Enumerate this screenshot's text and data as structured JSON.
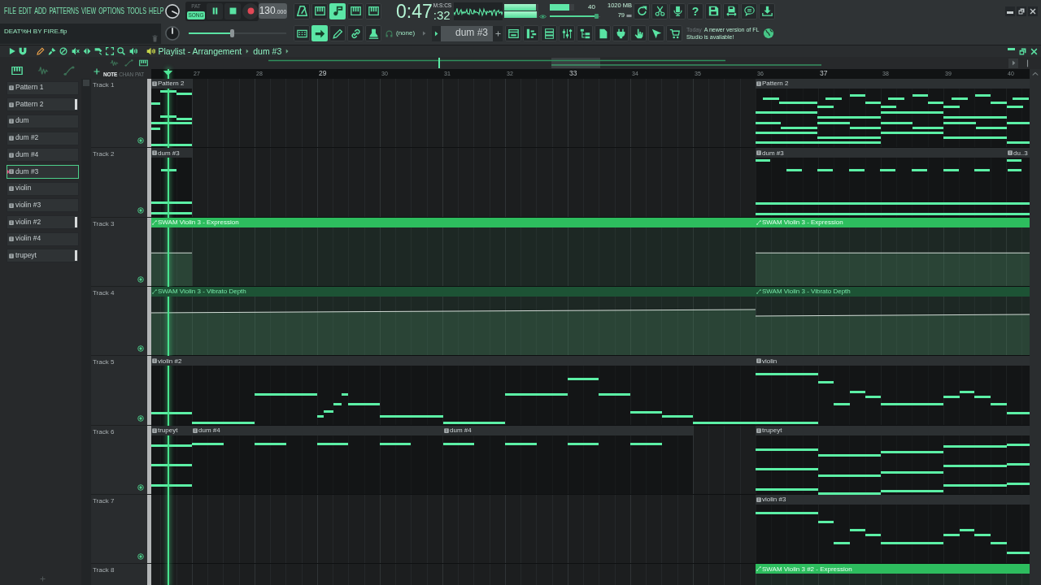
{
  "menu": [
    "FILE",
    "EDIT",
    "ADD",
    "PATTERNS",
    "VIEW",
    "OPTIONS",
    "TOOLS",
    "HELP"
  ],
  "project": {
    "filename": "DEAT%H BY FIRE.flp"
  },
  "transport": {
    "modes": [
      {
        "label": "PAT",
        "selected": false
      },
      {
        "label": "SONG",
        "selected": true
      }
    ],
    "tempo": {
      "whole": "130",
      "fraction": ".000"
    }
  },
  "record_tools": [
    {
      "on": false
    },
    {
      "on": false
    },
    {
      "on": true
    },
    {
      "on": false
    },
    {
      "on": false
    }
  ],
  "time": {
    "value": "0:47",
    "fraction": ":32",
    "unit": "M:S:CS"
  },
  "output_meter": {
    "channels": [
      {
        "level": 0.93
      },
      {
        "level": 0.95
      }
    ]
  },
  "cpu": {
    "level": 0.8,
    "reading": "40"
  },
  "polyphony": {
    "level": 0.97,
    "reading": "79"
  },
  "memory": {
    "reading": "1020 MB"
  },
  "help_label": "?",
  "master_volume": {
    "level": 0.44
  },
  "edit_tools": [
    {
      "on": false
    },
    {
      "on": true
    },
    {
      "on": false
    },
    {
      "on": false
    },
    {
      "on": false
    }
  ],
  "midi_input": {
    "value": "(none)"
  },
  "pattern_selector": {
    "value": "dum #3"
  },
  "news": {
    "date": "Today",
    "text": "A newer version of FL Studio is available!"
  },
  "playlist": {
    "title": "Playlist - Arrangement",
    "breadcrumb": "dum #3",
    "tools": [
      {
        "selected": true
      },
      {
        "selected": false
      },
      {
        "selected": false
      },
      {
        "selected": false
      },
      {
        "selected": false
      },
      {
        "selected": false
      },
      {
        "selected": false
      },
      {
        "selected": false
      },
      {
        "selected": false
      }
    ]
  },
  "picker": {
    "views": [
      {
        "selected": true
      },
      {
        "selected": false
      },
      {
        "selected": false
      }
    ],
    "modes": [
      {
        "selected": false
      },
      {
        "selected": false
      },
      {
        "selected": true
      }
    ],
    "filters": [
      {
        "label": "NOTE",
        "selected": true
      },
      {
        "label": "CHAN",
        "selected": false
      },
      {
        "label": "PAT",
        "selected": false
      }
    ],
    "patterns": [
      {
        "label": "Pattern 1",
        "selected": false,
        "marked": false
      },
      {
        "label": "Pattern 2",
        "selected": false,
        "marked": true
      },
      {
        "label": "dum",
        "selected": false,
        "marked": false
      },
      {
        "label": "dum #2",
        "selected": false,
        "marked": false
      },
      {
        "label": "dum #4",
        "selected": false,
        "marked": false
      },
      {
        "label": "dum #3",
        "selected": true,
        "marked": false
      },
      {
        "label": "violin",
        "selected": false,
        "marked": false
      },
      {
        "label": "violin #3",
        "selected": false,
        "marked": false
      },
      {
        "label": "violin #2",
        "selected": false,
        "marked": true
      },
      {
        "label": "violin #4",
        "selected": false,
        "marked": false
      },
      {
        "label": "trupeyt",
        "selected": false,
        "marked": true
      }
    ]
  },
  "ruler": [
    "27",
    "28",
    "29",
    "30",
    "31",
    "32",
    "33",
    "34",
    "35",
    "36",
    "37",
    "38",
    "39",
    "40"
  ],
  "tracks": [
    {
      "name": "Track 1",
      "clips": [
        {
          "kind": "pattern",
          "label": "Pattern 2"
        },
        {
          "kind": "pattern",
          "label": "Pattern 2"
        }
      ]
    },
    {
      "name": "Track 2",
      "clips": [
        {
          "kind": "pattern",
          "label": "dum #3"
        },
        {
          "kind": "pattern",
          "label": "dum #3"
        },
        {
          "kind": "pattern",
          "label": "du..3"
        }
      ]
    },
    {
      "name": "Track 3",
      "clips": [
        {
          "kind": "automation",
          "label": "SWAM Violin 3 - Expression",
          "color": "#2dbd5e"
        },
        {
          "kind": "automation",
          "label": "SWAM Violin 3 - Expression",
          "color": "#2dbd5e"
        }
      ]
    },
    {
      "name": "Track 4",
      "clips": [
        {
          "kind": "automation",
          "label": "SWAM Violin 3 - Vibrato Depth",
          "color": "#1d5335"
        },
        {
          "kind": "automation",
          "label": "SWAM Violin 3 - Vibrato Depth",
          "color": "#1d5335"
        }
      ]
    },
    {
      "name": "Track 5",
      "clips": [
        {
          "kind": "pattern",
          "label": "violin #2"
        },
        {
          "kind": "pattern",
          "label": "violin"
        }
      ]
    },
    {
      "name": "Track 6",
      "clips": [
        {
          "kind": "pattern",
          "label": "trupeyt"
        },
        {
          "kind": "pattern",
          "label": "dum #4"
        },
        {
          "kind": "pattern",
          "label": "dum #4"
        },
        {
          "kind": "pattern",
          "label": "trupeyt"
        }
      ]
    },
    {
      "name": "Track 7",
      "clips": [
        {
          "kind": "pattern",
          "label": "violin #3"
        }
      ]
    },
    {
      "name": "Track 8",
      "clips": [
        {
          "kind": "automation",
          "label": "SWAM Violin 3 #2 - Expression",
          "color": "#2dbd5e"
        }
      ]
    }
  ]
}
